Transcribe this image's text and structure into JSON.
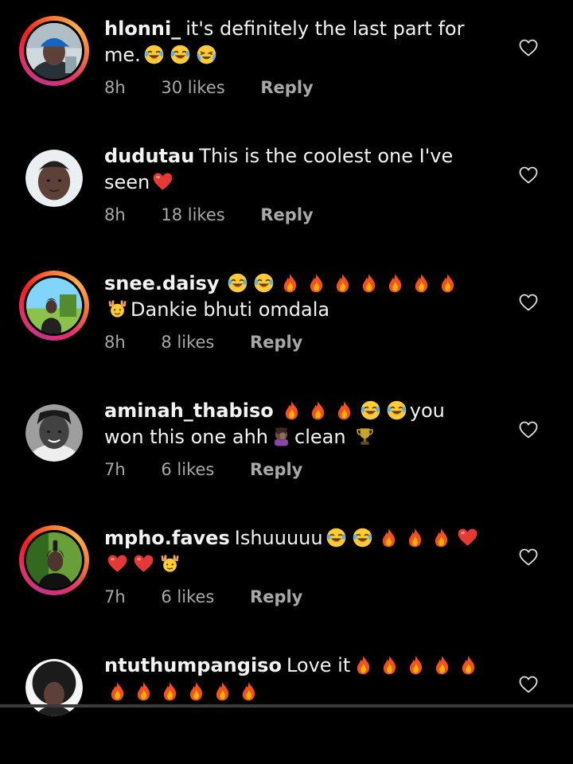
{
  "comments": [
    {
      "username": "hlonni_",
      "text_before": "it's definitely the last part for me.",
      "emojis": [
        "laugh",
        "laugh",
        "cry-laugh"
      ],
      "text_after": "",
      "time": "8h",
      "likes": "30 likes",
      "reply": "Reply",
      "has_story_ring": true,
      "avatar_icon": "person-cap-avatar"
    },
    {
      "username": "dudutau",
      "text_before": "This is the coolest one I've seen",
      "emojis": [
        "red-heart"
      ],
      "text_after": "",
      "time": "8h",
      "likes": "18 likes",
      "reply": "Reply",
      "has_story_ring": false,
      "avatar_icon": "person-portrait-avatar"
    },
    {
      "username": "snee.daisy",
      "text_before": "",
      "emojis": [
        "laugh",
        "laugh",
        "fire",
        "fire",
        "fire",
        "fire",
        "fire",
        "fire",
        "fire",
        "raised-hands"
      ],
      "text_after": "Dankie bhuti omdala",
      "time": "8h",
      "likes": "8 likes",
      "reply": "Reply",
      "has_story_ring": true,
      "avatar_icon": "person-outdoor-avatar"
    },
    {
      "username": "aminah_thabiso",
      "text_before": "",
      "emojis": [
        "fire",
        "fire",
        "fire",
        "laugh",
        "laugh"
      ],
      "text_after": "you won this one ahh",
      "emojis2": [
        "facepalm"
      ],
      "text_after2": "clean",
      "emojis3": [
        "trophy"
      ],
      "time": "7h",
      "likes": "6 likes",
      "reply": "Reply",
      "has_story_ring": false,
      "avatar_icon": "person-bw-avatar"
    },
    {
      "username": "mpho.faves",
      "text_before": "Ishuuuuu",
      "emojis": [
        "laugh",
        "laugh",
        "fire",
        "fire",
        "fire",
        "red-heart",
        "red-heart",
        "red-heart",
        "raised-hands"
      ],
      "text_after": "",
      "time": "7h",
      "likes": "6 likes",
      "reply": "Reply",
      "has_story_ring": true,
      "avatar_icon": "person-green-avatar"
    },
    {
      "username": "ntuthumpangiso",
      "text_before": "Love it",
      "emojis": [
        "fire",
        "fire",
        "fire",
        "fire",
        "fire",
        "fire",
        "fire",
        "fire",
        "fire",
        "fire",
        "fire"
      ],
      "text_after": "",
      "time": "",
      "likes": "",
      "reply": "",
      "has_story_ring": false,
      "avatar_icon": "person-afro-avatar"
    }
  ],
  "colors": {
    "background": "#000000",
    "text": "#f2f2f2",
    "meta": "#a8a8a8",
    "story_ring_start": "#c13584",
    "story_ring_end": "#fcaf45"
  }
}
